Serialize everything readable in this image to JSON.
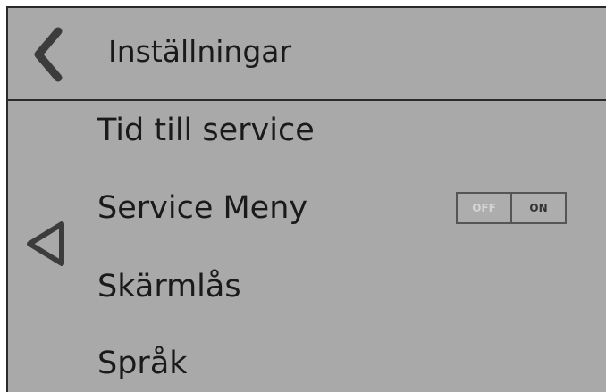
{
  "header": {
    "title": "Inställningar",
    "back_icon": "chevron-left-icon"
  },
  "side_nav": {
    "icon": "triangle-left-icon"
  },
  "menu": {
    "items": [
      {
        "label": "Tid till service"
      },
      {
        "label": "Service Meny"
      },
      {
        "label": "Skärmlås"
      },
      {
        "label": "Språk"
      }
    ]
  },
  "service_toggle": {
    "off_label": "OFF",
    "on_label": "ON",
    "state": "on"
  },
  "colors": {
    "background": "#a9a9a9",
    "border": "#2a2a2a",
    "text": "#1a1a1a",
    "icon": "#3c3c3c"
  }
}
